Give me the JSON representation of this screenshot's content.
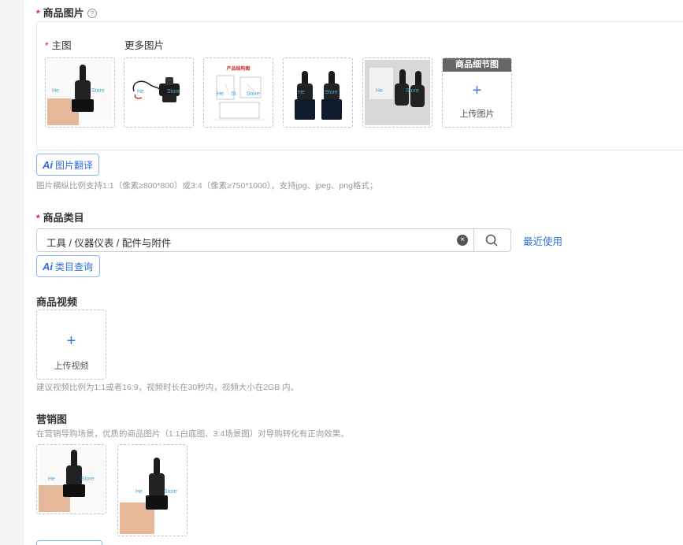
{
  "images_section": {
    "required_mark": "*",
    "title": "商品图片",
    "help_glyph": "?",
    "main_label_mark": "*",
    "main_label": "主图",
    "more_label": "更多图片",
    "watermark_1": "He",
    "watermark_2": "St",
    "watermark_3": "Store",
    "diagram_caption": "产品结构图",
    "detail_tag": "商品细节图",
    "upload_plus": "+",
    "upload_label": "上传图片",
    "ai_mark": "Ai",
    "ai_button_label": "图片翻译",
    "hint": "图片横纵比例支持1:1（像素≥800*800）或3:4（像素≥750*1000），支持jpg、jpeg、png格式；"
  },
  "category_section": {
    "required_mark": "*",
    "title": "商品类目",
    "value": "工具 / 仪器仪表 / 配件与附件",
    "clear_glyph": "×",
    "recent_link": "最近使用",
    "ai_mark": "Ai",
    "ai_button_label": "类目查询"
  },
  "video_section": {
    "title": "商品视频",
    "upload_plus": "+",
    "upload_label": "上传视频",
    "hint": "建议视频比例为1:1或者16:9，视频时长在30秒内，视频大小在2GB 内。"
  },
  "marketing_section": {
    "title": "营销图",
    "hint": "在营销导购场景，优质的商品图片（1:1白底图、3:4场景图）对导购转化有正向效果。",
    "watermark_1": "He",
    "watermark_3": "Store"
  },
  "colors": {
    "accent": "#2f6fd6",
    "required": "#e02020",
    "hint": "#999999"
  }
}
